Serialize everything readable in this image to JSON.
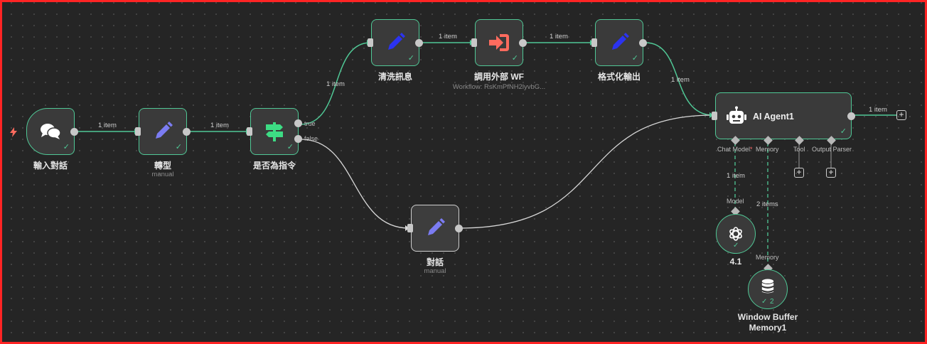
{
  "nodes": {
    "input": {
      "label": "輸入對話"
    },
    "transform": {
      "label": "轉型",
      "sub": "manual"
    },
    "if": {
      "label": "是否為指令",
      "true_label": "true",
      "false_label": "false"
    },
    "clean": {
      "label": "清洗訊息"
    },
    "callwf": {
      "label": "調用外部 WF",
      "sub": "Workflow: RsKmPfNH2lyvbG..."
    },
    "format": {
      "label": "格式化輸出"
    },
    "chat": {
      "label": "對話",
      "sub": "manual"
    },
    "agent": {
      "title": "AI Agent1",
      "ports": {
        "chat_model": "Chat Model",
        "required_mark": "*",
        "memory": "Memory",
        "tool": "Tool",
        "output_parser": "Output Parser"
      }
    },
    "model": {
      "label": "4.1",
      "port_label": "Model"
    },
    "memory": {
      "label_line1": "Window Buffer",
      "label_line2": "Memory1",
      "port_label": "Memory",
      "count": "2"
    }
  },
  "edges": {
    "input_transform": "1 item",
    "transform_if": "1 item",
    "if_clean": "1 item",
    "clean_callwf": "1 item",
    "callwf_format": "1 item",
    "format_agent": "1 item",
    "agent_out": "1 item",
    "model_agent": "1 item",
    "memory_agent": "2 items"
  },
  "colors": {
    "canvas": "#252525",
    "node_bg": "#3a3a3a",
    "success_border": "#50c896",
    "connection": "#50c896",
    "frame": "#ff2424",
    "edit_icon": "#7b7cf2",
    "edit_icon_dark": "#2b33f0",
    "if_icon": "#3ddc84",
    "execute_icon": "#ff6b5e"
  },
  "icons": {
    "input": "chat-bubbles-icon",
    "transform": "pencil-icon",
    "if": "signpost-icon",
    "clean": "pencil-icon",
    "callwf": "sign-in-icon",
    "format": "pencil-icon",
    "chat": "pencil-icon",
    "agent": "robot-icon",
    "model": "openai-icon",
    "memory": "database-icon",
    "trigger": "lightning-icon"
  }
}
